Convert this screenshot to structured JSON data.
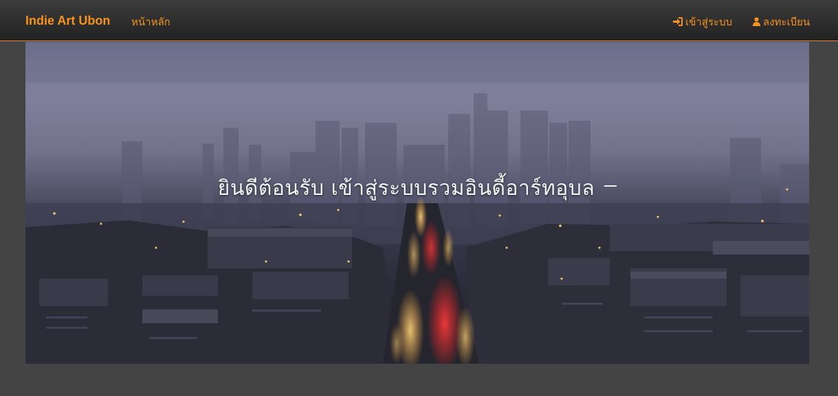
{
  "navbar": {
    "brand": "Indie Art Ubon",
    "home": "หน้าหลัก",
    "login": "เข้าสู่ระบบ",
    "register": "ลงทะเบียน",
    "accent_color": "#f7931e",
    "icons": {
      "login": "sign-in-icon",
      "register": "user-icon"
    }
  },
  "hero": {
    "title": "ยินดีต้อนรับ เข้าสู่ระบบรวมอินดี้อาร์ทอุบล"
  }
}
